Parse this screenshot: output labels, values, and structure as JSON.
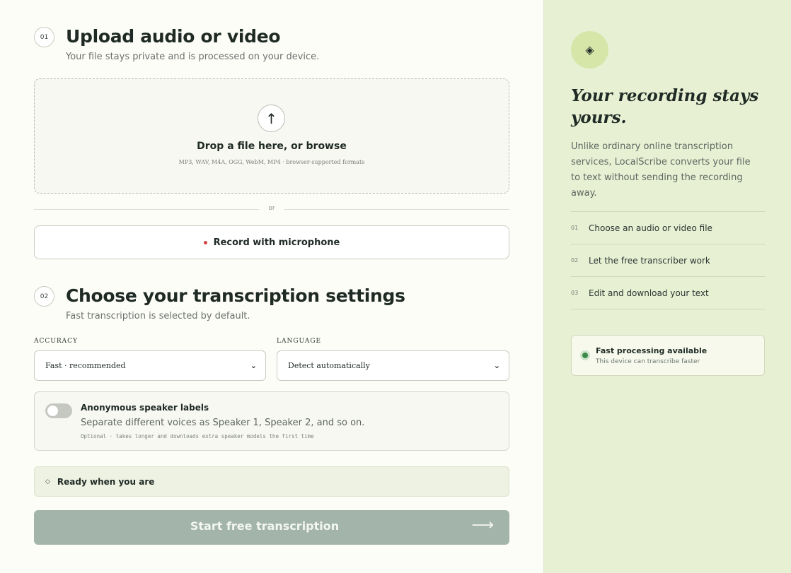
{
  "step1": {
    "badge": "01",
    "title": "Upload audio or video",
    "subtitle": "Your file stays private and is processed on your device."
  },
  "dropzone": {
    "icon": "upload-arrow-icon",
    "title": "Drop a file here, or browse",
    "formats": "MP3, WAV, M4A, OGG, WebM, MP4 · browser-supported formats"
  },
  "divider": {
    "text": "or"
  },
  "record": {
    "label": "Record with microphone",
    "dot_color": "#d24545"
  },
  "step2": {
    "badge": "02",
    "title": "Choose your transcription settings",
    "subtitle": "Fast transcription is selected by default."
  },
  "settings": {
    "accuracy_label": "ACCURACY",
    "accuracy_value": "Fast · recommended",
    "language_label": "LANGUAGE",
    "language_value": "Detect automatically"
  },
  "speakers": {
    "title": "Anonymous speaker labels",
    "description": "Separate different voices as Speaker 1, Speaker 2, and so on.",
    "note": "Optional · takes longer and downloads extra speaker models the first time",
    "enabled": false
  },
  "status": {
    "text": "Ready when you are"
  },
  "start": {
    "label": "Start free transcription",
    "arrow": "⟶",
    "color": "#a3b4ab"
  },
  "sidebar": {
    "icon": "diamond-icon",
    "tagline": "Your recording stays yours.",
    "blurb": "Unlike ordinary online transcription services, LocalScribe converts your file to text without sending the recording away.",
    "steps": [
      {
        "num": "01",
        "text": "Choose an audio or video file"
      },
      {
        "num": "02",
        "text": "Let the free transcriber work"
      },
      {
        "num": "03",
        "text": "Edit and download your text"
      }
    ],
    "fast": {
      "title": "Fast processing available",
      "subtitle": "This device can transcribe faster",
      "status_color": "#3d8a4a"
    }
  },
  "colors": {
    "accent_panel": "#e8f0d4",
    "page_bg": "#fdfdf8",
    "text": "#1f2a25"
  }
}
